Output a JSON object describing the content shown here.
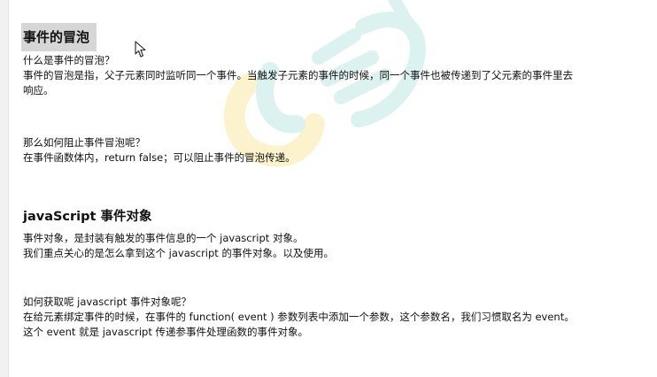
{
  "section1": {
    "title": "事件的冒泡",
    "question": "什么是事件的冒泡？",
    "answer_line1": "事件的冒泡是指，父子元素同时监听同一个事件。当触发子元素的事件的时候，同一个事件也被传递到了父元素的事件里去",
    "answer_line2": "响应。",
    "q2": "那么如何阻止事件冒泡呢？",
    "a2": "在事件函数体内，return false；可以阻止事件的冒泡传递。"
  },
  "section2": {
    "title": "javaScript 事件对象",
    "line1": "事件对象，是封装有触发的事件信息的一个 javascript 对象。",
    "line2": "我们重点关心的是怎么拿到这个 javascript 的事件对象。以及使用。",
    "q": "如何获取呢 javascript 事件对象呢？",
    "a1": "在给元素绑定事件的时候，在事件的 function( event ) 参数列表中添加一个参数，这个参数名，我们习惯取名为 event。",
    "a2": "这个 event 就是 javascript 传递参事件处理函数的事件对象。"
  },
  "watermark": {
    "colors": {
      "teal": "#bfe9e6",
      "yellow": "#fbe9a6"
    }
  },
  "icons": {
    "cursor": "mouse-pointer-icon"
  }
}
